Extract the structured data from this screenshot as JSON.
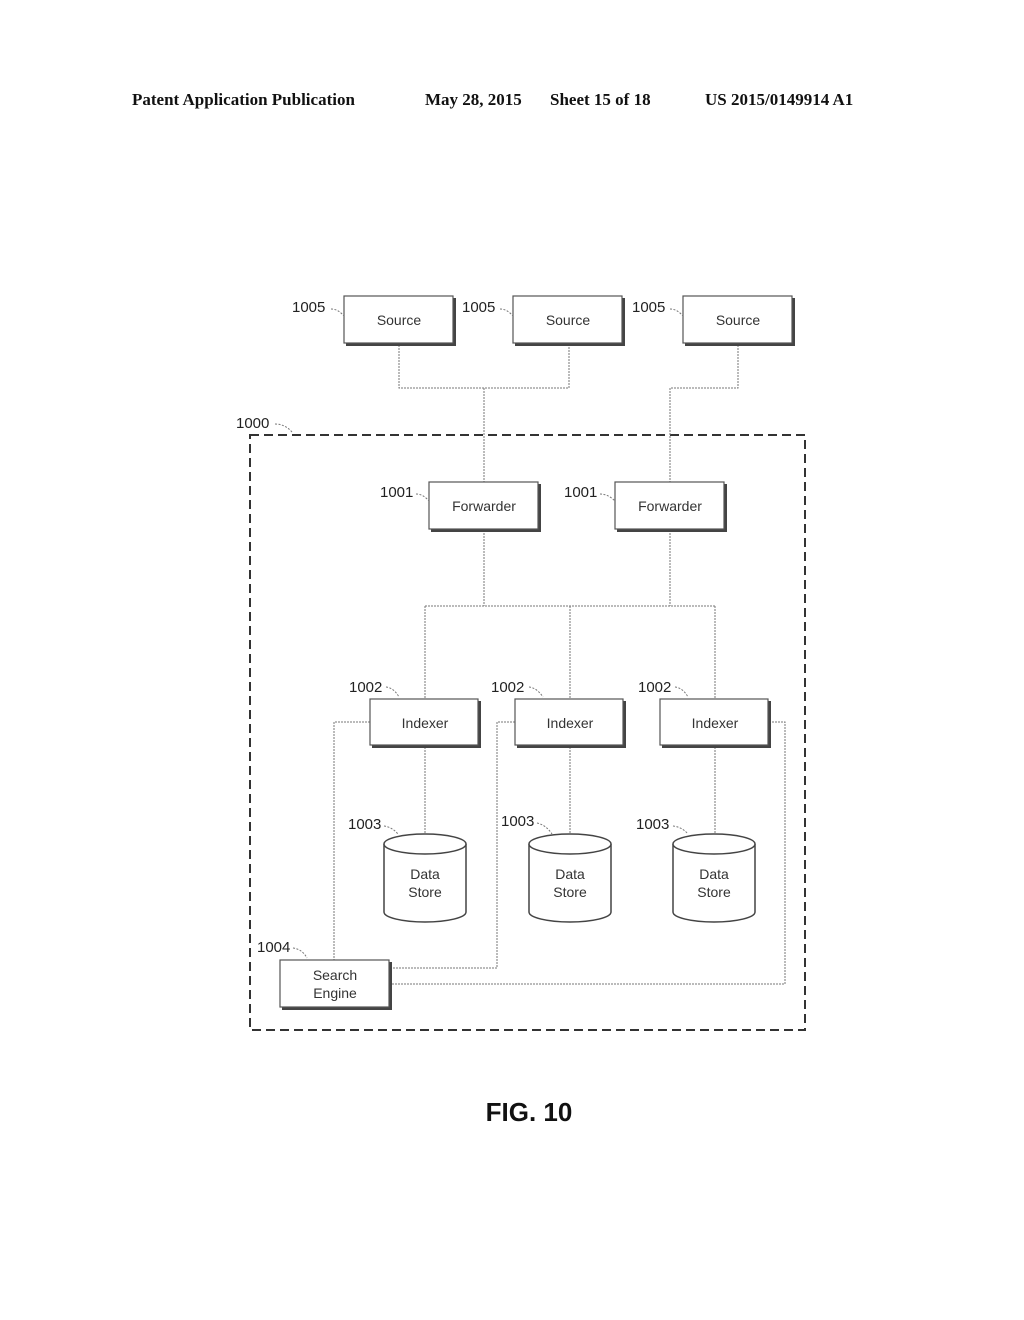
{
  "header": {
    "publication": "Patent Application Publication",
    "date": "May 28, 2015",
    "sheet": "Sheet 15 of 18",
    "number": "US 2015/0149914 A1"
  },
  "diagram": {
    "system": {
      "ref": "1000"
    },
    "sources": [
      {
        "ref": "1005",
        "label": "Source"
      },
      {
        "ref": "1005",
        "label": "Source"
      },
      {
        "ref": "1005",
        "label": "Source"
      }
    ],
    "forwarders": [
      {
        "ref": "1001",
        "label": "Forwarder"
      },
      {
        "ref": "1001",
        "label": "Forwarder"
      }
    ],
    "indexers": [
      {
        "ref": "1002",
        "label": "Indexer"
      },
      {
        "ref": "1002",
        "label": "Indexer"
      },
      {
        "ref": "1002",
        "label": "Indexer"
      }
    ],
    "data_stores": [
      {
        "ref": "1003",
        "line1": "Data",
        "line2": "Store"
      },
      {
        "ref": "1003",
        "line1": "Data",
        "line2": "Store"
      },
      {
        "ref": "1003",
        "line1": "Data",
        "line2": "Store"
      }
    ],
    "search_engine": {
      "ref": "1004",
      "line1": "Search",
      "line2": "Engine"
    }
  },
  "figure": {
    "caption": "FIG. 10"
  }
}
